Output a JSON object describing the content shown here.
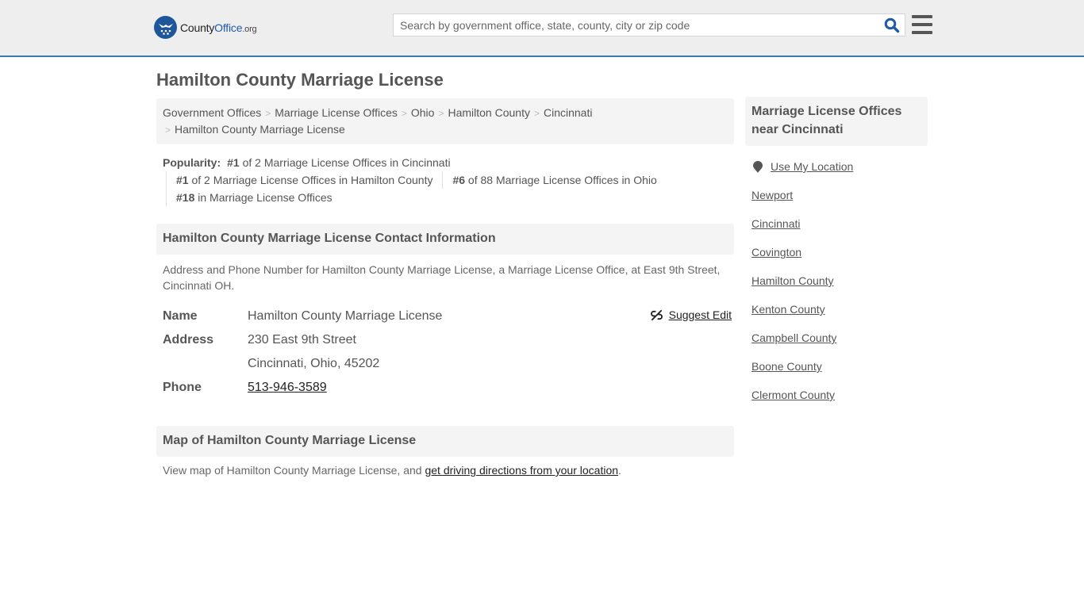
{
  "header": {
    "logo": {
      "name": "County",
      "brand": "Office",
      "tld": ".org"
    },
    "search": {
      "placeholder": "Search by government office, state, county, city or zip code",
      "value": ""
    },
    "accent_color": "#3a7bb0"
  },
  "page": {
    "title": "Hamilton County Marriage License"
  },
  "breadcrumb": [
    {
      "label": "Government Offices"
    },
    {
      "label": "Marriage License Offices"
    },
    {
      "label": "Ohio"
    },
    {
      "label": "Hamilton County"
    },
    {
      "label": "Cincinnati"
    },
    {
      "label": "Hamilton County Marriage License"
    }
  ],
  "popularity": {
    "label": "Popularity:",
    "items": [
      {
        "rank": "#1",
        "text": " of 2 Marriage License Offices in Cincinnati"
      },
      {
        "rank": "#1",
        "text": " of 2 Marriage License Offices in Hamilton County"
      },
      {
        "rank": "#6",
        "text": " of 88 Marriage License Offices in Ohio"
      },
      {
        "rank": "#18",
        "text": " in Marriage License Offices"
      }
    ]
  },
  "contact": {
    "heading": "Hamilton County Marriage License Contact Information",
    "description": "Address and Phone Number for Hamilton County Marriage License, a Marriage License Office, at East 9th Street, Cincinnati OH.",
    "suggest_edit": "Suggest Edit",
    "name_label": "Name",
    "name_value": "Hamilton County Marriage License",
    "address_label": "Address",
    "address_line1": "230 East 9th Street",
    "address_line2": "Cincinnati, Ohio, 45202",
    "phone_label": "Phone",
    "phone_value": "513-946-3589"
  },
  "map": {
    "heading": "Map of Hamilton County Marriage License",
    "desc_prefix": "View map of Hamilton County Marriage License, and ",
    "directions_link": "get driving directions from your location",
    "desc_suffix": "."
  },
  "sidebar": {
    "heading": "Marriage License Offices near Cincinnati",
    "use_location": "Use My Location",
    "links": [
      "Newport",
      "Cincinnati",
      "Covington",
      "Hamilton County",
      "Kenton County",
      "Campbell County",
      "Boone County",
      "Clermont County"
    ]
  }
}
